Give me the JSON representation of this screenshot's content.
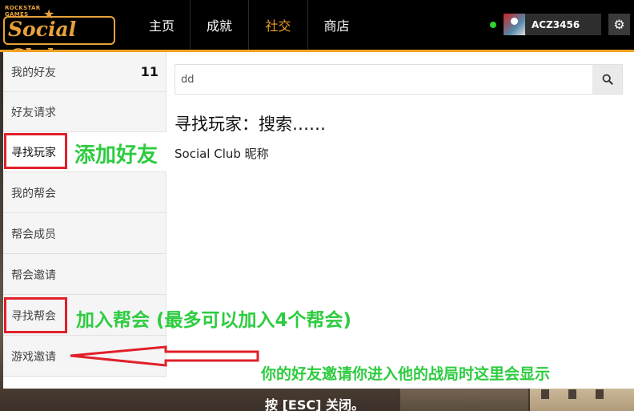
{
  "nav": {
    "logo_top": "ROCKSTAR\nGAMES",
    "logo_text": "Social Club",
    "items": [
      {
        "label": "主页"
      },
      {
        "label": "成就"
      },
      {
        "label": "社交"
      },
      {
        "label": "商店"
      }
    ],
    "active": "社交"
  },
  "profile": {
    "username": "ACZ3456",
    "status_color": "#2ed32e"
  },
  "sidebar": {
    "items": [
      {
        "label": "我的好友",
        "count": "11"
      },
      {
        "label": "好友请求"
      },
      {
        "label": "寻找玩家"
      },
      {
        "label": "我的帮会"
      },
      {
        "label": "帮会成员"
      },
      {
        "label": "帮会邀请"
      },
      {
        "label": "寻找帮会"
      },
      {
        "label": "游戏邀请"
      }
    ],
    "active_index": 2
  },
  "search": {
    "value": "dd",
    "placeholder": ""
  },
  "content": {
    "title": "寻找玩家：搜索……",
    "subtitle": "Social Club 昵称"
  },
  "esc_hint": "按 [ESC] 关闭。",
  "annotations": {
    "add_friend": "添加好友",
    "join_crew": "加入帮会 (最多可以加入4个帮会)",
    "game_invite_note": "你的好友邀请你进入他的战局时这里会显示"
  },
  "colors": {
    "accent": "#f0a020",
    "annotation_red": "#e0202a",
    "annotation_green": "#2ecc40"
  }
}
